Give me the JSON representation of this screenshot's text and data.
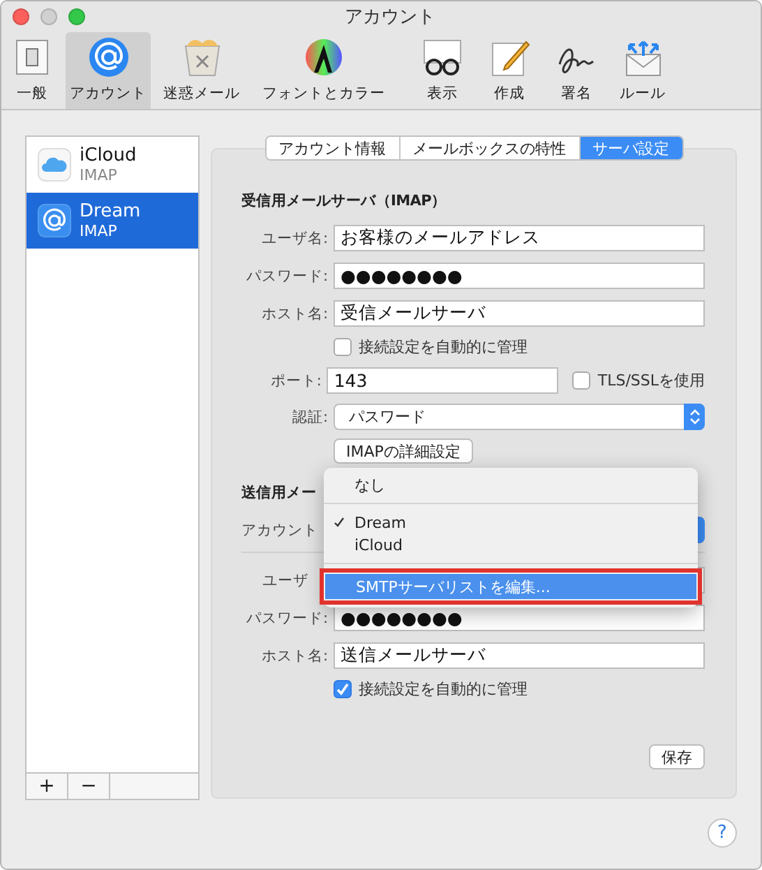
{
  "window": {
    "title": "アカウント"
  },
  "toolbar": [
    {
      "label": "一般",
      "kind": "general",
      "selected": false
    },
    {
      "label": "アカウント",
      "kind": "accounts",
      "selected": true
    },
    {
      "label": "迷惑メール",
      "kind": "junk",
      "selected": false
    },
    {
      "label": "フォントとカラー",
      "kind": "fonts",
      "selected": false
    },
    {
      "label": "表示",
      "kind": "viewing",
      "selected": false
    },
    {
      "label": "作成",
      "kind": "composing",
      "selected": false
    },
    {
      "label": "署名",
      "kind": "signatures",
      "selected": false
    },
    {
      "label": "ルール",
      "kind": "rules",
      "selected": false
    }
  ],
  "sidebar": {
    "accounts": [
      {
        "name": "iCloud",
        "type": "IMAP",
        "kind": "cloud",
        "selected": false
      },
      {
        "name": "Dream",
        "type": "IMAP",
        "kind": "at",
        "selected": true
      }
    ],
    "buttons": [
      "+",
      "−"
    ]
  },
  "tabs": [
    {
      "label": "アカウント情報",
      "selected": false
    },
    {
      "label": "メールボックスの特性",
      "selected": false
    },
    {
      "label": "サーバ設定",
      "selected": true
    }
  ],
  "incoming": {
    "title": "受信用メールサーバ（IMAP）",
    "user": {
      "label": "ユーザ名:",
      "value": "お客様のメールアドレス"
    },
    "password": {
      "label": "パスワード:",
      "value": "●●●●●●●●"
    },
    "host": {
      "label": "ホスト名:",
      "value": "受信メールサーバ"
    },
    "auto_manage": {
      "label": "接続設定を自動的に管理",
      "checked": false
    },
    "port": {
      "label": "ポート:",
      "value": "143"
    },
    "tls": {
      "label": "TLS/SSLを使用",
      "checked": false
    },
    "auth": {
      "label": "認証:",
      "value": "パスワード"
    },
    "advanced_button": "IMAPの詳細設定"
  },
  "outgoing": {
    "title": "送信用メー",
    "account_label": "アカウント",
    "user_label": "ユーザ",
    "password": {
      "label": "パスワード:",
      "value": "●●●●●●●●"
    },
    "host": {
      "label": "ホスト名:",
      "value": "送信メールサーバ"
    },
    "auto_manage": {
      "label": "接続設定を自動的に管理",
      "checked": true
    }
  },
  "save_button": "保存",
  "help_button": "?",
  "dropdown_menu": {
    "items": [
      {
        "kind": "item",
        "label": "なし",
        "checked": false,
        "highlighted": false
      },
      {
        "kind": "separator"
      },
      {
        "kind": "item",
        "label": "Dream",
        "checked": true,
        "highlighted": false
      },
      {
        "kind": "item",
        "label": "iCloud",
        "checked": false,
        "highlighted": false
      },
      {
        "kind": "separator"
      },
      {
        "kind": "item",
        "label": "SMTPサーバリストを編集...",
        "checked": false,
        "highlighted": true
      }
    ]
  }
}
